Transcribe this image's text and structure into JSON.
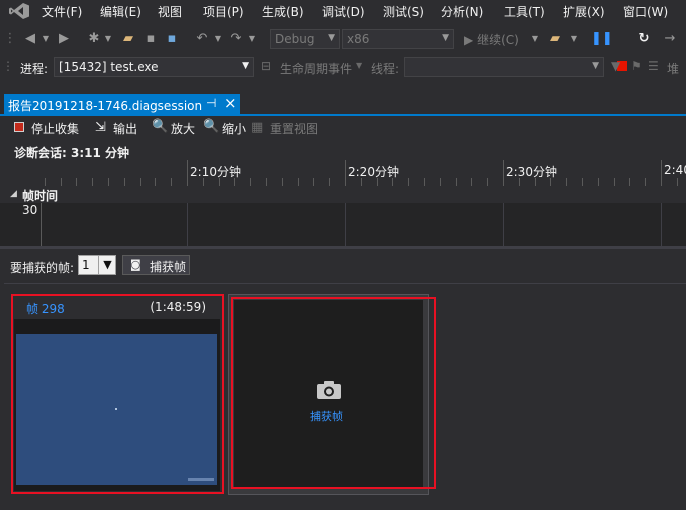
{
  "menu": {
    "items": [
      "文件(F)",
      "编辑(E)",
      "视图",
      "项目(P)",
      "生成(B)",
      "调试(D)",
      "测试(S)",
      "分析(N)",
      "工具(T)",
      "扩展(X)",
      "窗口(W)"
    ]
  },
  "toolbar": {
    "config_dropdown": "Debug",
    "platform_dropdown": "x86",
    "continue_label": "继续(C)"
  },
  "process_bar": {
    "process_label": "进程:",
    "process_value": "[15432] test.exe",
    "lifecycle_label": "生命周期事件",
    "thread_label": "线程:",
    "stack_label": "堆"
  },
  "document_tab": {
    "title": "报告20191218-1746.diagsession",
    "pin_glyph": "⊣",
    "close_glyph": "×"
  },
  "session_toolbar": {
    "stop_label": "停止收集",
    "output_label": "输出",
    "zoom_in_label": "放大",
    "zoom_out_label": "缩小",
    "reset_view_label": "重置视图"
  },
  "session": {
    "label": "诊断会话: 3:11 分钟"
  },
  "timeline": {
    "tick_labels": [
      "2:10分钟",
      "2:20分钟",
      "2:30分钟",
      "2:40"
    ],
    "lane_title": "帧时间",
    "lane_value": "30"
  },
  "capture": {
    "frames_label": "要捕获的帧:",
    "frames_value": "1",
    "capture_button_label": "捕获帧"
  },
  "frames": {
    "frame_title": "帧 298",
    "frame_time": "(1:48:59)",
    "placeholder_label": "捕获帧"
  },
  "colors": {
    "accent": "#007acc",
    "highlight": "#e81123",
    "frame_blue": "#2e4d7d"
  }
}
